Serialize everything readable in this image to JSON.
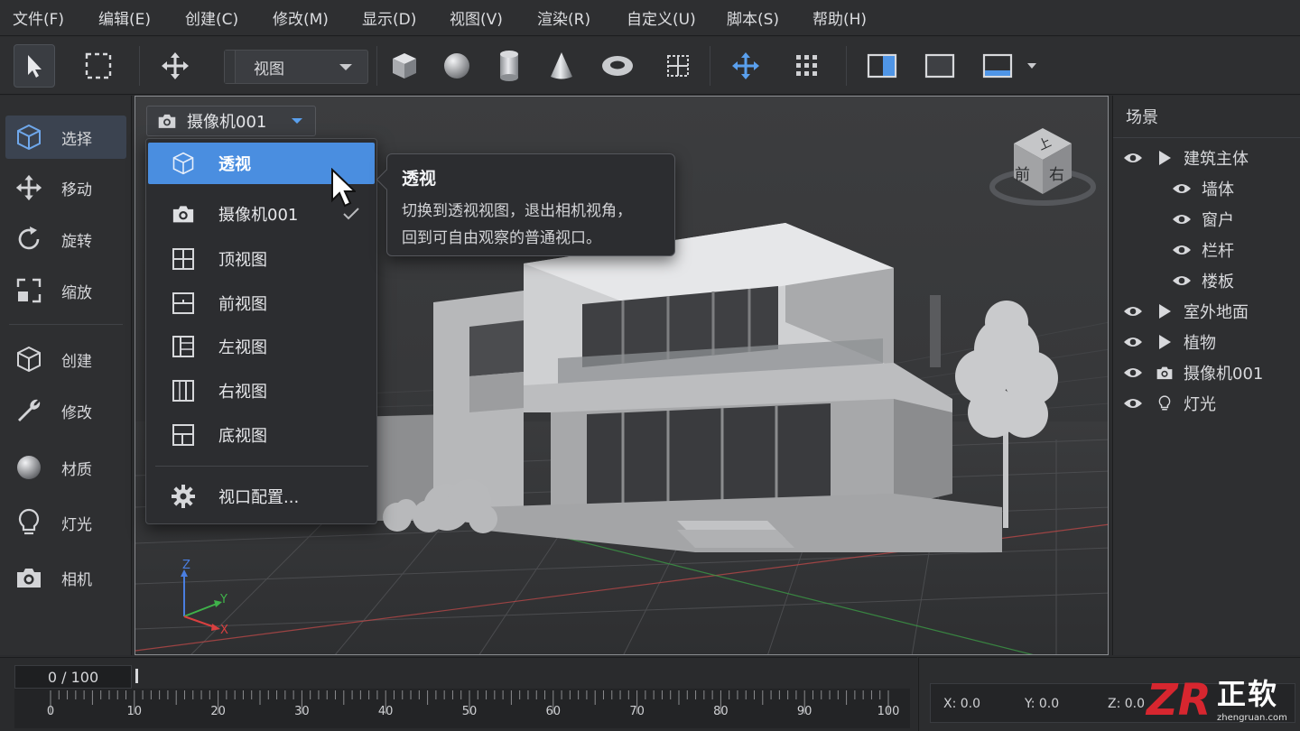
{
  "menubar": {
    "items": [
      "文件(F)",
      "编辑(E)",
      "创建(C)",
      "修改(M)",
      "显示(D)",
      "视图(V)",
      "渲染(R)",
      "自定义(U)",
      "脚本(S)",
      "帮助(H)"
    ]
  },
  "toolbar": {
    "view_select": "视图",
    "icons": [
      "select-arrow-icon",
      "marquee-select-icon",
      "move-arrows-icon",
      "box-primitive-icon",
      "sphere-primitive-icon",
      "cylinder-primitive-icon",
      "cone-primitive-icon",
      "torus-primitive-icon",
      "snap-grid-icon",
      "transform-gizmo-icon",
      "array-grid-icon",
      "split-view-icon",
      "single-view-icon",
      "layout-view-icon"
    ]
  },
  "left_panel": {
    "items": [
      {
        "label": "选择",
        "icon": "cube-select-icon",
        "active": true
      },
      {
        "label": "移动",
        "icon": "move-icon"
      },
      {
        "label": "旋转",
        "icon": "rotate-icon"
      },
      {
        "label": "缩放",
        "icon": "scale-icon"
      },
      {
        "label": "创建",
        "icon": "create-cube-icon"
      },
      {
        "label": "修改",
        "icon": "wrench-icon"
      },
      {
        "label": "材质",
        "icon": "material-sphere-icon"
      },
      {
        "label": "灯光",
        "icon": "light-bulb-icon"
      },
      {
        "label": "相机",
        "icon": "camera-icon"
      }
    ]
  },
  "viewport": {
    "camera_select": "摄像机001",
    "nav_cube": {
      "top": "上",
      "front": "前",
      "right": "右"
    },
    "axes": {
      "x": "X",
      "y": "Y",
      "z": "Z"
    }
  },
  "dropdown": {
    "items": [
      {
        "label": "透视",
        "icon": "perspective-cube-icon",
        "highlight": true
      },
      {
        "label": "摄像机001",
        "icon": "camera-icon",
        "checked": true
      },
      {
        "label": "顶视图",
        "icon": "top-view-icon"
      },
      {
        "label": "前视图",
        "icon": "front-view-icon"
      },
      {
        "label": "左视图",
        "icon": "left-view-icon"
      },
      {
        "label": "右视图",
        "icon": "right-view-icon"
      },
      {
        "label": "底视图",
        "icon": "bottom-view-icon"
      }
    ],
    "config_label": "视口配置..."
  },
  "tooltip": {
    "title": "透视",
    "line1": "切换到透视视图，退出相机视角，",
    "line2": "回到可自由观察的普通视口。"
  },
  "scene_panel": {
    "title": "场景",
    "items": [
      {
        "label": "建筑主体",
        "level": 0,
        "expander": true
      },
      {
        "label": "墙体",
        "level": 1
      },
      {
        "label": "窗户",
        "level": 1
      },
      {
        "label": "栏杆",
        "level": 1
      },
      {
        "label": "楼板",
        "level": 1
      },
      {
        "label": "室外地面",
        "level": 0,
        "expander": true
      },
      {
        "label": "植物",
        "level": 0,
        "expander": true
      },
      {
        "label": "摄像机001",
        "level": 0,
        "icon": "camera-icon"
      },
      {
        "label": "灯光",
        "level": 0,
        "icon": "light-bulb-icon"
      }
    ]
  },
  "timeline": {
    "frame": "0 / 100",
    "ticks": [
      "0",
      "10",
      "20",
      "30",
      "40",
      "50",
      "60",
      "70",
      "80",
      "90",
      "100"
    ]
  },
  "status": {
    "x": "X:  0.0",
    "y": "Y:  0.0",
    "z": "Z:  0.0"
  },
  "watermark": {
    "logo": "ZR",
    "text": "正软",
    "url": "zhengruan.com"
  },
  "colors": {
    "accent": "#4a8ee0",
    "background": "#2b2c2e",
    "axis_x": "#d94040",
    "axis_y": "#3fb24a",
    "axis_z": "#4a7ee0"
  }
}
